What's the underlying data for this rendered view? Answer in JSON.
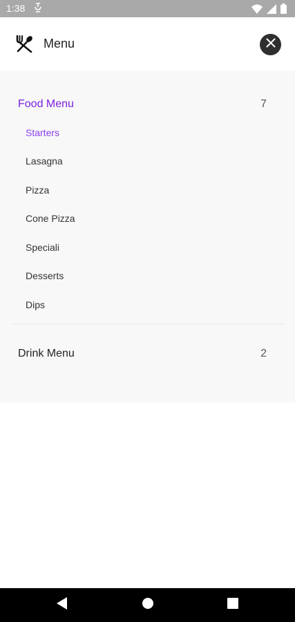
{
  "status_bar": {
    "time": "1:38",
    "notification_icon": "sync-icon",
    "icons": [
      "wifi-icon",
      "signal-icon",
      "battery-icon"
    ]
  },
  "header": {
    "title": "Menu",
    "icon": "utensils-icon",
    "close_icon": "close-icon"
  },
  "menu": {
    "categories": [
      {
        "label": "Food Menu",
        "count": "7",
        "active": true,
        "items": [
          {
            "label": "Starters",
            "active": true
          },
          {
            "label": "Lasagna",
            "active": false
          },
          {
            "label": "Pizza",
            "active": false
          },
          {
            "label": "Cone Pizza",
            "active": false
          },
          {
            "label": "Speciali",
            "active": false
          },
          {
            "label": "Desserts",
            "active": false
          },
          {
            "label": "Dips",
            "active": false
          }
        ]
      },
      {
        "label": "Drink Menu",
        "count": "2",
        "active": false,
        "items": []
      }
    ]
  },
  "nav_bar": {
    "buttons": [
      "back-icon",
      "home-icon",
      "recents-icon"
    ]
  },
  "colors": {
    "accent": "#7b1fe0",
    "status_bar": "#a9a9a9",
    "panel_bg": "#f8f8f8"
  }
}
